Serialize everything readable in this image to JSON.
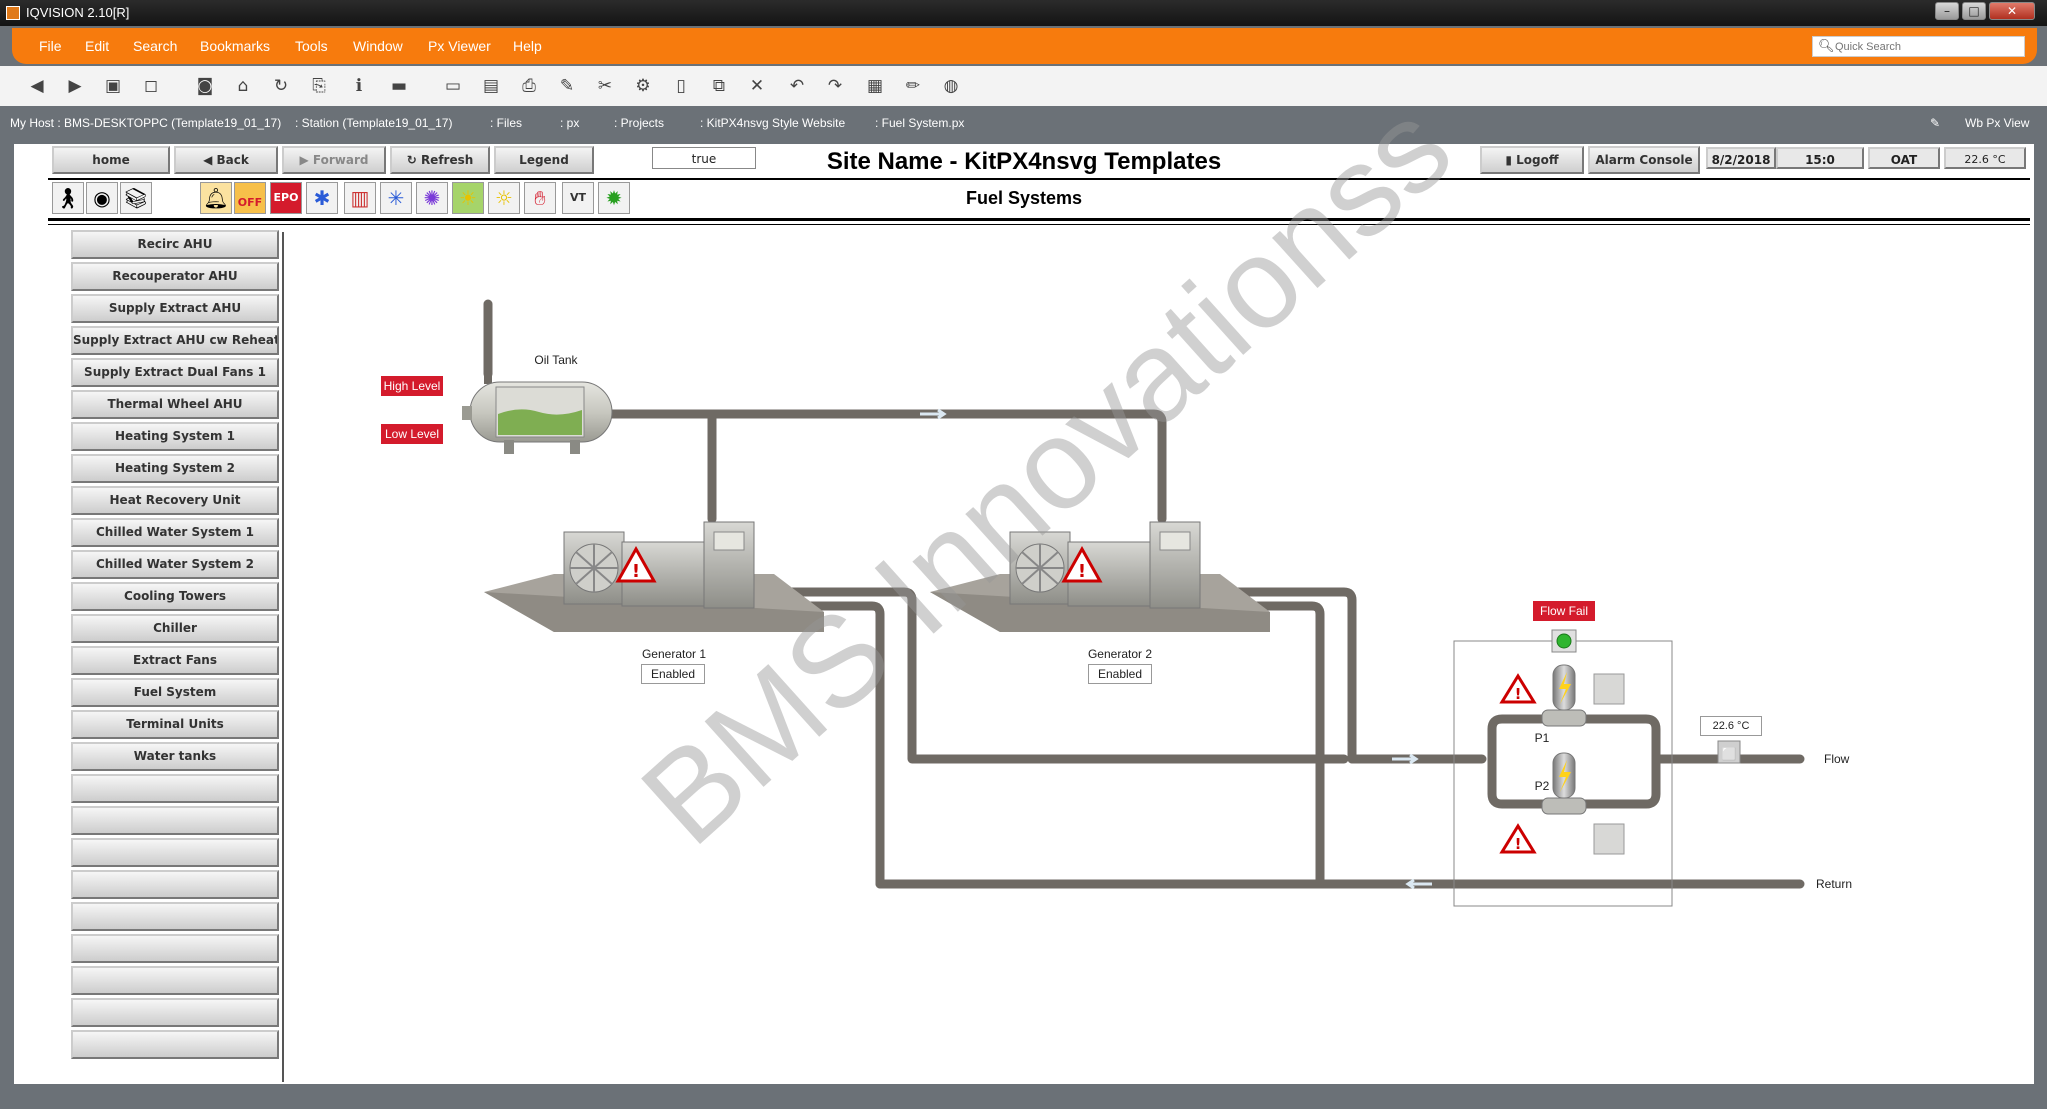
{
  "window": {
    "title": "IQVISION 2.10[R]"
  },
  "menu": [
    "File",
    "Edit",
    "Search",
    "Bookmarks",
    "Tools",
    "Window",
    "Px Viewer",
    "Help"
  ],
  "quick_search": {
    "placeholder": "Quick Search"
  },
  "path": [
    "My Host : BMS-DESKTOPPC (Template19_01_17)",
    ": Station (Template19_01_17)",
    ": Files",
    ": px",
    ": Projects",
    ": KitPX4nsvg Style Website",
    ": Fuel System.px"
  ],
  "wb_view": "Wb Px View",
  "nav": {
    "home": "home",
    "back": "Back",
    "forward": "Forward",
    "refresh": "Refresh",
    "legend": "Legend",
    "true_field": "true",
    "logoff": "Logoff",
    "alarm_console": "Alarm Console",
    "date": "8/2/2018",
    "time": "15:0",
    "oat_label": "OAT",
    "oat_value": "22.6 °C"
  },
  "site_name": "Site Name - KitPX4nsvg Templates",
  "page_title": "Fuel Systems",
  "toolbar_icons": [
    "occupant-icon",
    "meter-icon",
    "book-icon",
    "fire-alarm-icon",
    "off-icon",
    "epo-icon",
    "lightning-icon",
    "window-icon",
    "lighting-icon",
    "burst-icon",
    "landscape-icon",
    "sun-icon",
    "hand-icon",
    "vt-icon",
    "sunburst-icon"
  ],
  "sidebar": [
    "Recirc AHU",
    "Recouperator AHU",
    "Supply Extract AHU",
    "Supply Extract AHU cw Reheats",
    "Supply Extract Dual Fans 1",
    "Thermal Wheel AHU",
    "Heating System 1",
    "Heating System 2",
    "Heat Recovery Unit",
    "Chilled Water System 1",
    "Chilled Water System 2",
    "Cooling Towers",
    "Chiller",
    "Extract Fans",
    "Fuel System",
    "Terminal Units",
    "Water tanks",
    "",
    "",
    "",
    "",
    "",
    "",
    "",
    "",
    ""
  ],
  "diagram": {
    "oil_tank": "Oil Tank",
    "high_level": "High Level",
    "low_level": "Low Level",
    "generator1": {
      "name": "Generator 1",
      "status": "Enabled"
    },
    "generator2": {
      "name": "Generator 2",
      "status": "Enabled"
    },
    "flow_fail": "Flow Fail",
    "p1": "P1",
    "p2": "P2",
    "temp": "22.6 °C",
    "flow": "Flow",
    "return": "Return"
  },
  "watermark": "BMS Innovationss",
  "colors": {
    "menu_orange": "#f77b0d",
    "alarm_red": "#d41b2c",
    "pipe": "#6f6a64"
  }
}
